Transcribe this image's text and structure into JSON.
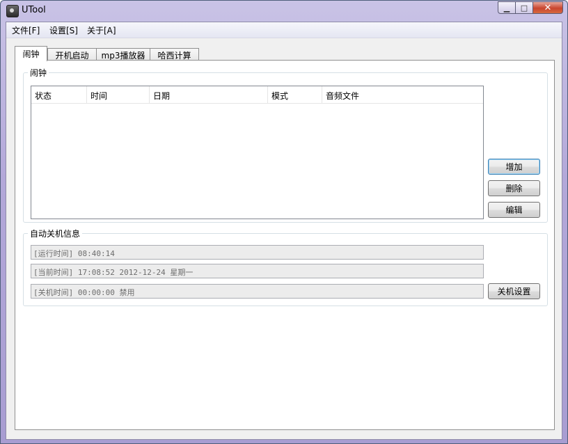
{
  "window": {
    "title": "UTool"
  },
  "caption": {
    "minimize": "▁",
    "maximize": "□",
    "close": "✕"
  },
  "menu": [
    "文件[F]",
    "设置[S]",
    "关于[A]"
  ],
  "tabs": [
    "闹钟",
    "开机启动",
    "mp3播放器",
    "哈西计算"
  ],
  "alarm_group": {
    "title": "闹钟",
    "columns": [
      "状态",
      "时间",
      "日期",
      "模式",
      "音频文件"
    ],
    "rows": [],
    "buttons": {
      "add": "增加",
      "delete": "删除",
      "edit": "编辑"
    }
  },
  "shutdown_group": {
    "title": "自动关机信息",
    "run_time": "[运行时间] 08:40:14",
    "current_time": "[当前时间] 17:08:52 2012-12-24 星期一",
    "shutdown_time": "[关机时间] 00:00:00 禁用",
    "settings_button": "关机设置"
  }
}
